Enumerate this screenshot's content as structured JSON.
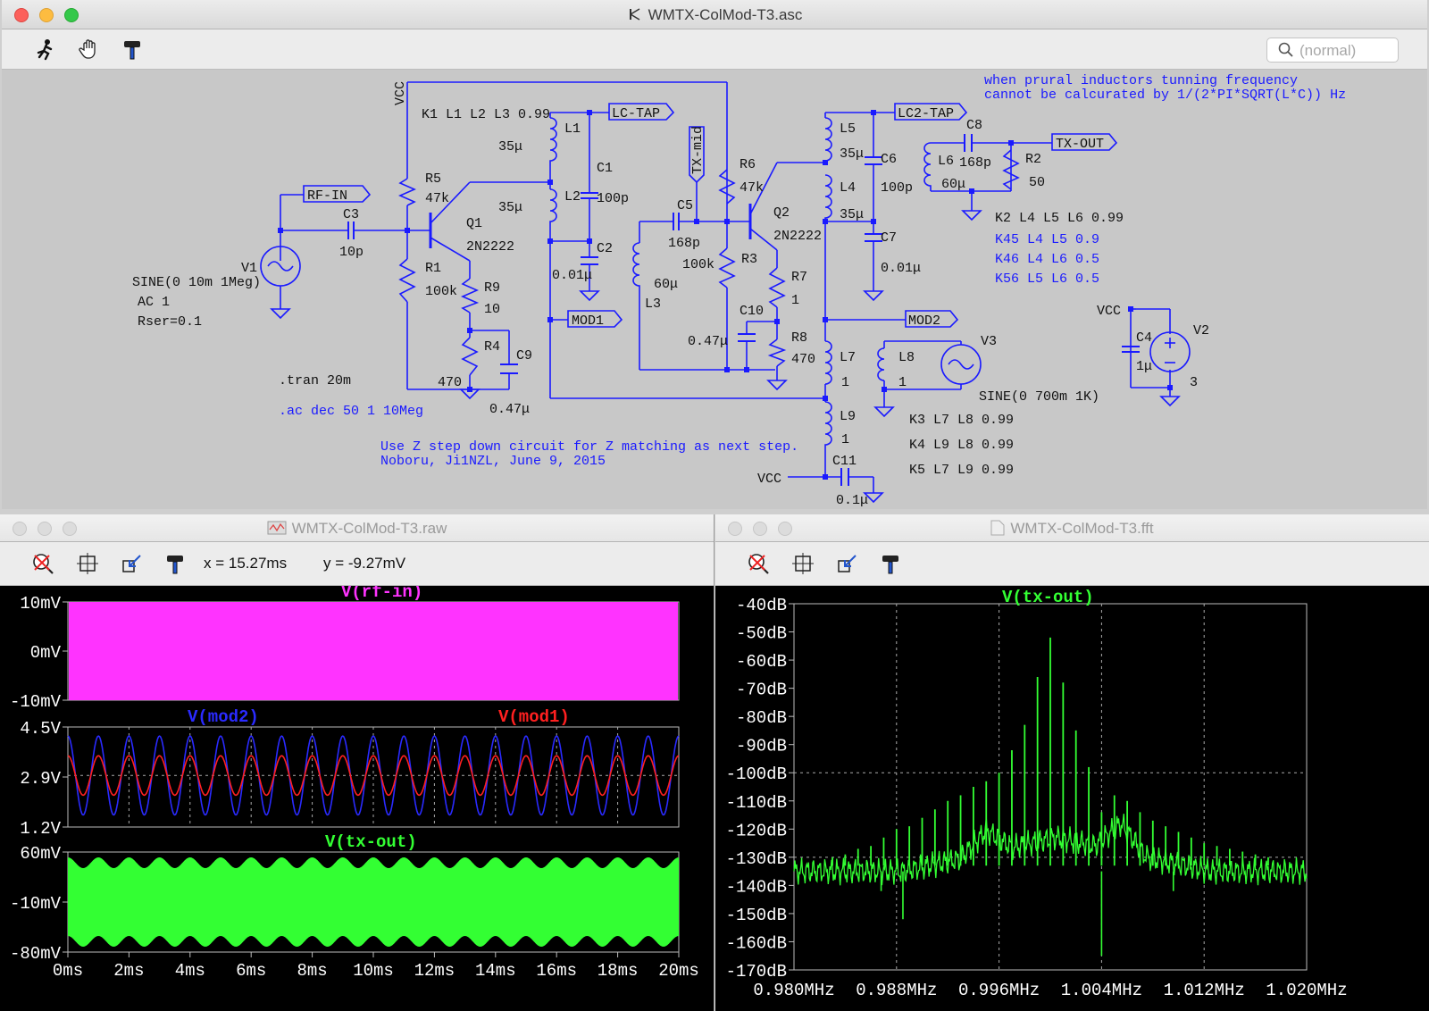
{
  "schematic_window": {
    "title": "WMTX-ColMod-T3.asc",
    "search_placeholder": "(normal)",
    "tools": [
      "run-icon",
      "pan-hand-icon",
      "hammer-icon"
    ],
    "labels": {
      "vcc_top": "VCC",
      "k1": "K1 L1 L2 L3 0.99",
      "l1": "L1",
      "l1_val": "35μ",
      "l2": "L2",
      "l2_val": "35μ",
      "lc_tap": "LC-TAP",
      "c1": "C1",
      "c1_val": "100p",
      "c2": "C2",
      "c2_val": "0.01μ",
      "mod1": "MOD1",
      "r5": "R5",
      "r5_val": "47k",
      "r1": "R1",
      "r1_val": "100k",
      "q1": "Q1",
      "q1_val": "2N2222",
      "r9": "R9",
      "r9_val": "10",
      "r4": "R4",
      "r4_val": "470",
      "c9": "C9",
      "c9_val": "0.47μ",
      "rf_in": "RF-IN",
      "c3": "C3",
      "c3_val": "10p",
      "v1": "V1",
      "v1_sine": "SINE(0 10m 1Meg)",
      "v1_ac": "AC 1",
      "v1_rser": "Rser=0.1",
      "tran": ".tran 20m",
      "ac": ".ac dec 50 1 10Meg",
      "note1": "Use Z step down circuit for Z matching as next step.",
      "note2": "Noboru, Ji1NZL, June 9, 2015",
      "tx_mid": "TX-mid",
      "c5": "C5",
      "c5_val": "168p",
      "l3": "L3",
      "l3_val": "60μ",
      "r6": "R6",
      "r6_val": "47k",
      "r3": "R3",
      "r3_val": "100k",
      "q2": "Q2",
      "q2_val": "2N2222",
      "r7": "R7",
      "r7_val": "1",
      "c10": "C10",
      "c10_val": "0.47μ",
      "r8": "R8",
      "r8_val": "470",
      "l5": "L5",
      "l5_val": "35μ",
      "l4": "L4",
      "l4_val": "35μ",
      "lc2_tap": "LC2-TAP",
      "c6": "C6",
      "c6_val": "100p",
      "c7": "C7",
      "c7_val": "0.01μ",
      "c8": "C8",
      "l6": "L6",
      "l6_c8_val": "168p",
      "l6_val": "60μ",
      "r2": "R2",
      "r2_val": "50",
      "tx_out": "TX-OUT",
      "k2": "K2 L4 L5 L6 0.99",
      "k45": "K45 L4 L5  0.9",
      "k46": "K46 L4 L6  0.5",
      "k56": "K56 L5 L6  0.5",
      "note_freq1": "when prural inductors tunning frequency",
      "note_freq2": "cannot be calcurated by 1/(2*PI*SQRT(L*C)) Hz",
      "mod2": "MOD2",
      "l7": "L7",
      "l7_val": "1",
      "l8": "L8",
      "l8_val": "1",
      "v3": "V3",
      "v3_sine": "SINE(0 700m 1K)",
      "l9": "L9",
      "l9_val": "1",
      "k3": "K3 L7 L8 0.99",
      "k4": "K4 L9 L8 0.99",
      "k5": "K5 L7 L9 0.99",
      "vcc_bottom": "VCC",
      "c11": "C11",
      "c11_val": "0.1μ",
      "vcc_right": "VCC",
      "c4": "C4",
      "c4_val": "1μ",
      "v2": "V2",
      "v2_val": "3"
    }
  },
  "raw_window": {
    "title": "WMTX-ColMod-T3.raw",
    "readout_x": "x = 15.27ms",
    "readout_y": "y = -9.27mV"
  },
  "fft_window": {
    "title": "WMTX-ColMod-T3.fft"
  },
  "colors": {
    "rf_in": "#ff33ff",
    "mod2": "#2a2aff",
    "mod1": "#ff2020",
    "tx_out": "#33ff33",
    "schematic_blue": "#1a1aff"
  },
  "chart_data": [
    {
      "type": "area",
      "title": "V(rf-in)",
      "x_ticks": [],
      "y_ticks": [
        "10mV",
        "0mV",
        "-10mV"
      ],
      "ylim": [
        -10,
        10
      ],
      "series": [
        {
          "name": "V(rf-in)",
          "description_values": {
            "amplitude_mV": 10,
            "frequency_Hz": 1000000
          }
        }
      ]
    },
    {
      "type": "line",
      "title": "",
      "y_ticks": [
        "4.5V",
        "2.9V",
        "1.2V"
      ],
      "ylim": [
        1.2,
        4.5
      ],
      "series": [
        {
          "name": "V(mod2)",
          "center": 2.9,
          "amplitude": 1.3,
          "cycles": 20
        },
        {
          "name": "V(mod1)",
          "center": 2.9,
          "amplitude": 0.65,
          "cycles": 20
        }
      ]
    },
    {
      "type": "area",
      "title": "V(tx-out)",
      "y_ticks": [
        "60mV",
        "-10mV",
        "-80mV"
      ],
      "x_ticks": [
        "0ms",
        "2ms",
        "4ms",
        "6ms",
        "8ms",
        "10ms",
        "12ms",
        "14ms",
        "16ms",
        "18ms",
        "20ms"
      ],
      "xlim": [
        0,
        20
      ],
      "ylim": [
        -80,
        60
      ],
      "series": [
        {
          "name": "V(tx-out)",
          "envelope_cycles": 20
        }
      ]
    },
    {
      "type": "line",
      "title": "V(tx-out)",
      "y_ticks": [
        "-40dB",
        "-50dB",
        "-60dB",
        "-70dB",
        "-80dB",
        "-90dB",
        "-100dB",
        "-110dB",
        "-120dB",
        "-130dB",
        "-140dB",
        "-150dB",
        "-160dB",
        "-170dB"
      ],
      "x_ticks": [
        "0.980MHz",
        "0.988MHz",
        "0.996MHz",
        "1.004MHz",
        "1.012MHz",
        "1.020MHz"
      ],
      "xlim": [
        0.98,
        1.02
      ],
      "ylim": [
        -170,
        -40
      ],
      "series": [
        {
          "name": "V(tx-out)",
          "spikes_MHz": [
            0.983,
            0.984,
            0.985,
            0.986,
            0.987,
            0.988,
            0.989,
            0.99,
            0.991,
            0.992,
            0.993,
            0.994,
            0.995,
            0.996,
            0.997,
            0.998,
            0.999,
            1.0,
            1.001,
            1.002,
            1.003,
            1.004,
            1.005,
            1.006,
            1.007,
            1.008,
            1.009,
            1.01,
            1.011,
            1.012,
            1.013,
            1.014,
            1.015,
            1.016,
            1.017
          ],
          "spikes_dB": [
            -130,
            -129,
            -127,
            -126,
            -123,
            -120,
            -119,
            -116,
            -113,
            -110,
            -108,
            -105,
            -103,
            -100,
            -92,
            -83,
            -66,
            -52,
            -68,
            -85,
            -98,
            -114,
            -108,
            -110,
            -114,
            -117,
            -119,
            -121,
            -123,
            -125,
            -126,
            -127,
            -128,
            -129,
            -130
          ],
          "noise_floor_dB": -135
        }
      ]
    }
  ]
}
